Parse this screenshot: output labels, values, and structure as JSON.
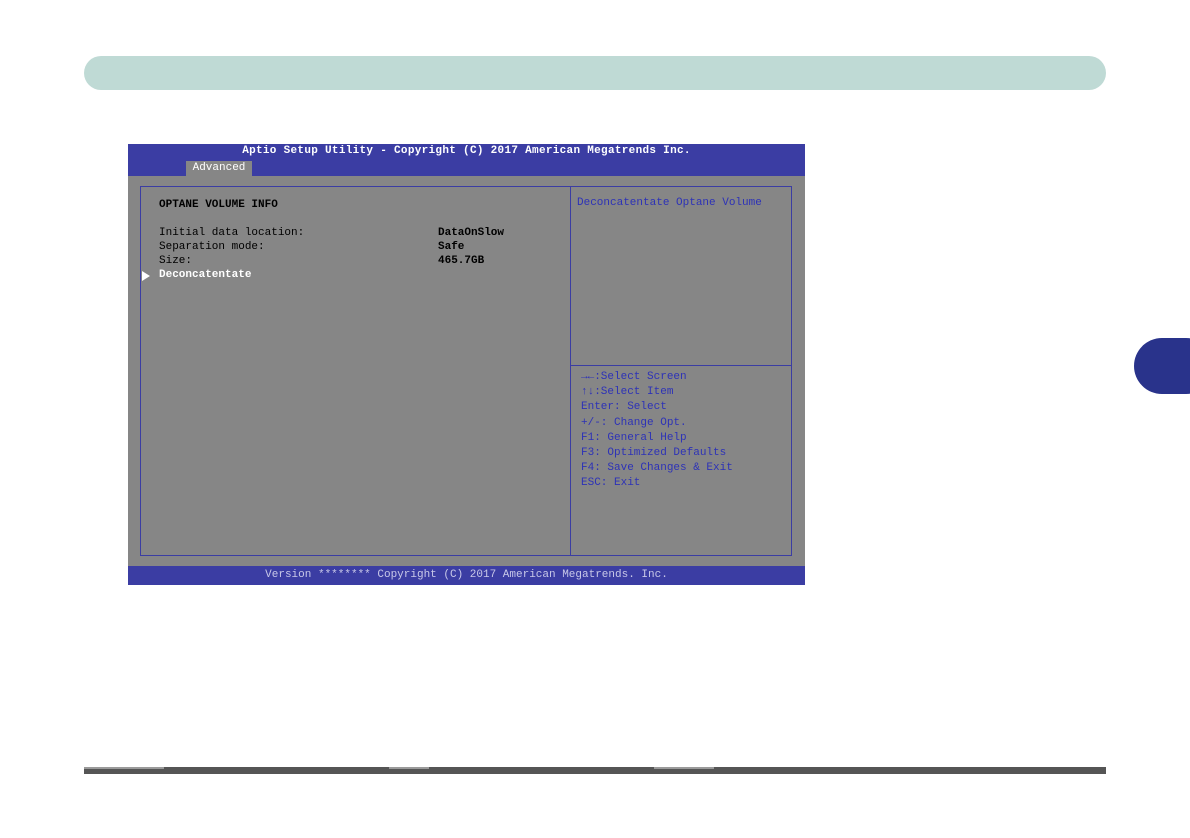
{
  "bios": {
    "title": "Aptio Setup Utility - Copyright (C) 2017 American Megatrends Inc.",
    "active_tab": "Advanced",
    "section_title": "OPTANE VOLUME INFO",
    "settings": [
      {
        "label": "Initial data location:",
        "value": "DataOnSlow"
      },
      {
        "label": "Separation mode:",
        "value": "Safe"
      },
      {
        "label": "Size:",
        "value": "465.7GB"
      }
    ],
    "menu_item": "Deconcatentate",
    "help_text": "Deconcatentate Optane Volume",
    "key_help": [
      "→←:Select Screen",
      "↑↓:Select Item",
      "Enter: Select",
      "+/-: Change Opt.",
      "F1: General Help",
      "F3: Optimized Defaults",
      "F4: Save Changes & Exit",
      "ESC: Exit"
    ],
    "footer": "Version ******** Copyright (C) 2017 American Megatrends. Inc."
  },
  "colors": {
    "header_bar": "#bfdad5",
    "chapter_tab": "#29338b",
    "bios_blue": "#3b3da3",
    "bios_gray": "#868686",
    "help_text": "#2d32b7"
  }
}
